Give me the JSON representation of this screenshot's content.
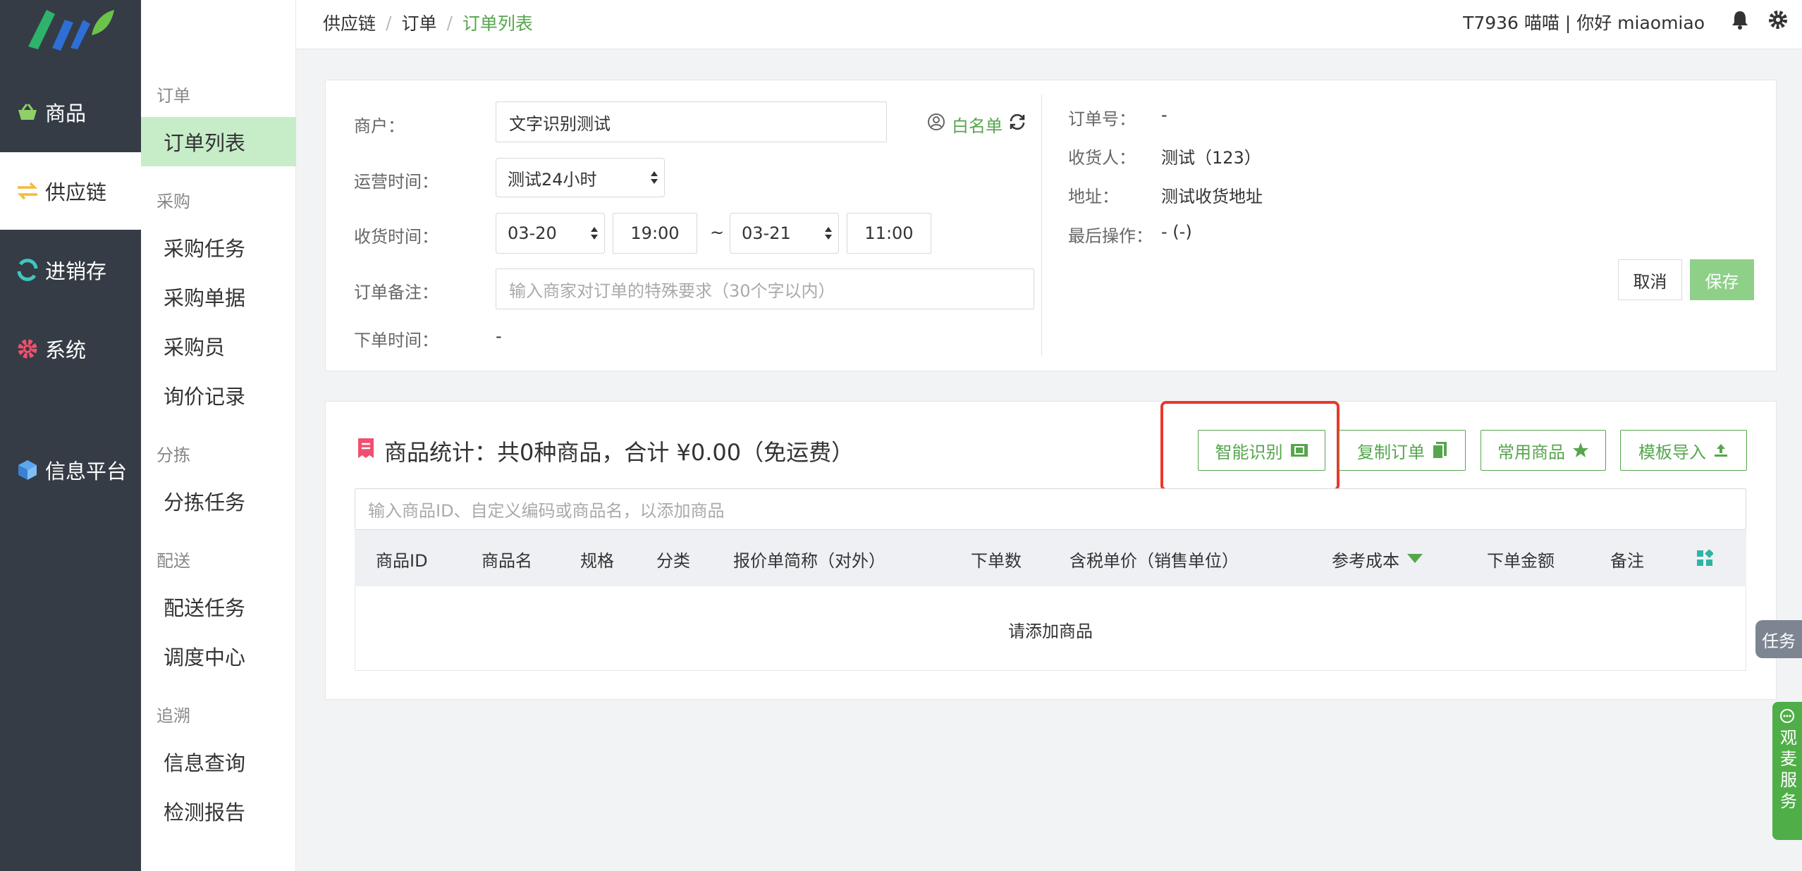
{
  "nav": {
    "items": [
      {
        "label": "商品",
        "icon": "basket-icon"
      },
      {
        "label": "供应链",
        "icon": "exchange-icon"
      },
      {
        "label": "进销存",
        "icon": "cycle-icon"
      },
      {
        "label": "系统",
        "icon": "gear-icon"
      },
      {
        "label": "信息平台",
        "icon": "cube-icon"
      }
    ]
  },
  "subnav": {
    "groups": [
      "订单",
      "采购",
      "分拣",
      "配送",
      "追溯"
    ],
    "items": [
      "订单列表",
      "采购任务",
      "采购单据",
      "采购员",
      "询价记录",
      "分拣任务",
      "配送任务",
      "调度中心",
      "信息查询",
      "检测报告"
    ]
  },
  "breadcrumb": [
    "供应链",
    "订单",
    "订单列表"
  ],
  "breadcrumb_sep": "/",
  "user": {
    "text": "T7936 喵喵 | 你好 miaomiao"
  },
  "order_form": {
    "merchant_label": "商户：",
    "merchant_value": "文字识别测试",
    "whitelist_label": "白名单",
    "ops_time_label": "运营时间：",
    "ops_time_value": "测试24小时",
    "receive_label": "收货时间：",
    "receive_start_date": "03-20",
    "receive_start_time": "19:00",
    "receive_tilde": "~",
    "receive_end_date": "03-21",
    "receive_end_time": "11:00",
    "remark_label": "订单备注：",
    "remark_placeholder": "输入商家对订单的特殊要求（30个字以内）",
    "order_time_label": "下单时间：",
    "order_time_value": "-"
  },
  "order_info": {
    "order_no_label": "订单号：",
    "order_no_value": "-",
    "receiver_label": "收货人：",
    "receiver_value": "测试（123）",
    "address_label": "地址：",
    "address_value": "测试收货地址",
    "last_op_label": "最后操作：",
    "last_op_value": "- (-)",
    "cancel": "取消",
    "save": "保存"
  },
  "goods": {
    "summary": "商品统计：共0种商品，合计 ¥0.00（免运费）",
    "buttons": [
      "智能识别",
      "复制订单",
      "常用商品",
      "模板导入"
    ],
    "search_placeholder": "输入商品ID、自定义编码或商品名，以添加商品",
    "columns": [
      "商品ID",
      "商品名",
      "规格",
      "分类",
      "报价单简称（对外）",
      "下单数",
      "含税单价（销售单位）",
      "参考成本",
      "下单金额",
      "备注"
    ],
    "empty": "请添加商品"
  },
  "side_tabs": {
    "task": "任务",
    "service": "观麦服务"
  },
  "colors": {
    "brand_green": "#56a64d",
    "highlight_red": "#e8392b",
    "nav_dark": "#353c45",
    "teal": "#2fb4a4"
  }
}
